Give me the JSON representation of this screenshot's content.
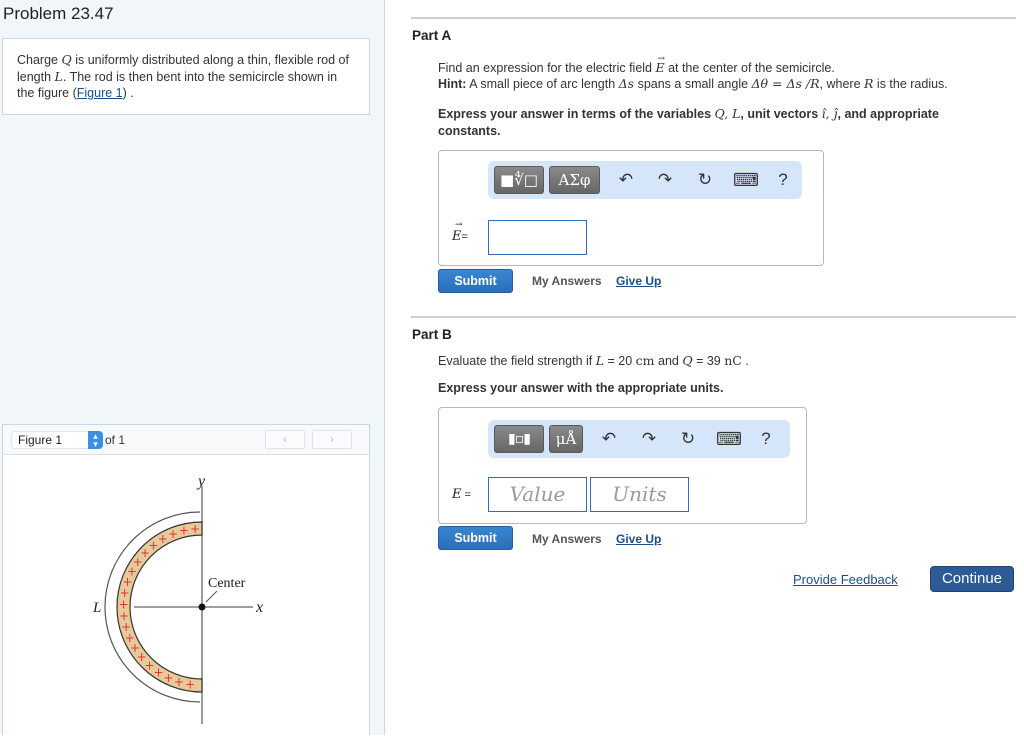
{
  "problem": {
    "title": "Problem 23.47",
    "intro": {
      "t1": "Charge ",
      "q": "Q",
      "t2": " is uniformly distributed along a thin, flexible rod of length ",
      "l": "L",
      "t3": ". The rod is then bent into the semicircle shown in the figure (",
      "figure_link": "Figure 1",
      "t4": ") ."
    }
  },
  "figure_panel": {
    "selected": "Figure 1",
    "of_label": "of 1",
    "prev_icon": "‹",
    "next_icon": "›",
    "labels": {
      "y_axis": "y",
      "x_axis": "x",
      "center": "Center",
      "length": "L"
    }
  },
  "part_a": {
    "title": "Part A",
    "line1_a": "Find an expression for the electric field ",
    "line1_var": "E",
    "line1_b": " at the center of the semicircle.",
    "hint_label": "Hint:",
    "hint_a": " A small piece of arc length ",
    "hint_math1": "Δs",
    "hint_b": " spans a small angle ",
    "hint_math2": "Δθ = Δs /R",
    "hint_c": ", where ",
    "hint_math3": "R",
    "hint_d": " is the radius.",
    "express_a": "Express your answer in terms of the variables ",
    "express_vars": "Q, L",
    "express_b": ", unit vectors ",
    "express_units": "î, ĵ",
    "express_c": ", and appropriate",
    "express_d": "constants.",
    "toolbar": {
      "template_btn": "■∜□",
      "greek_btn": "ΑΣφ",
      "undo": "↶",
      "redo": "↷",
      "reset": "↻",
      "keyboard": "⌨",
      "help": "?"
    },
    "eq_label_var": "E",
    "eq_label_sign": "=",
    "answer_value": "",
    "submit": "Submit",
    "my_answers": "My Answers",
    "give_up": "Give Up"
  },
  "part_b": {
    "title": "Part B",
    "line1_a": "Evaluate the field strength if ",
    "l_var": "L",
    "l_eq": " = 20 ",
    "l_unit": "cm",
    "and": " and ",
    "q_var": "Q",
    "q_eq": " = 39 ",
    "q_unit": "nC",
    "line1_end": " .",
    "express": "Express your answer with the appropriate units.",
    "toolbar": {
      "template_btn": "▮▫▮",
      "units_btn": "μÅ",
      "undo": "↶",
      "redo": "↷",
      "reset": "↻",
      "keyboard": "⌨",
      "help": "?"
    },
    "eq_label_var": "E",
    "eq_label_sign": " =",
    "value_placeholder": "Value",
    "units_placeholder": "Units",
    "submit": "Submit",
    "my_answers": "My Answers",
    "give_up": "Give Up"
  },
  "footer": {
    "feedback": "Provide Feedback",
    "continue": "Continue"
  }
}
